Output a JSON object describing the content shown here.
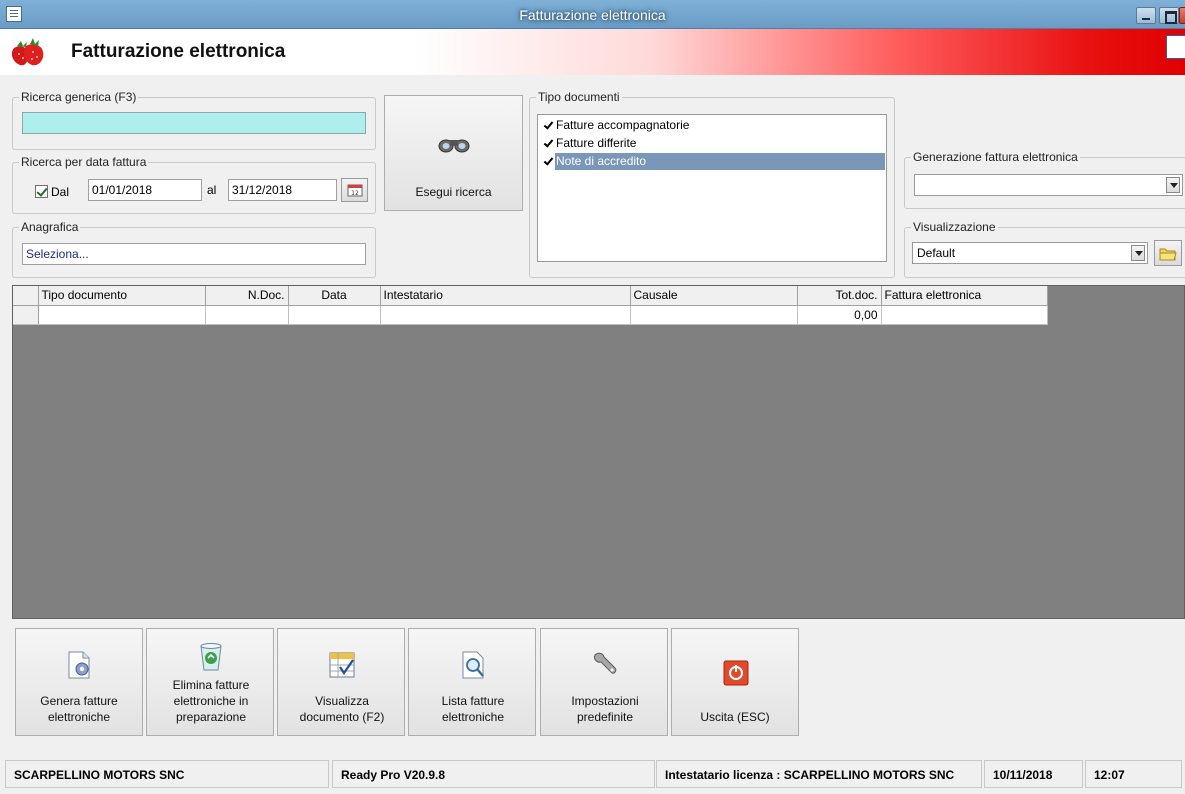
{
  "window": {
    "title": "Fatturazione elettronica"
  },
  "header": {
    "title": "Fatturazione elettronica"
  },
  "search_generic": {
    "legend": "Ricerca generica (F3)",
    "value": ""
  },
  "search_date": {
    "legend": "Ricerca per data fattura",
    "dal_label": "Dal",
    "dal_checked": true,
    "date_from": "01/01/2018",
    "al_label": "al",
    "date_to": "31/12/2018"
  },
  "anagrafica": {
    "legend": "Anagrafica",
    "value": "Seleziona..."
  },
  "search_button": {
    "label": "Esegui ricerca"
  },
  "document_types": {
    "legend": "Tipo documenti",
    "items": [
      {
        "label": "Fatture accompagnatorie",
        "checked": true,
        "selected": false
      },
      {
        "label": "Fatture differite",
        "checked": true,
        "selected": false
      },
      {
        "label": "Note di accredito",
        "checked": true,
        "selected": true
      }
    ]
  },
  "generation": {
    "legend": "Generazione fattura elettronica",
    "value": ""
  },
  "view": {
    "legend": "Visualizzazione",
    "value": "Default"
  },
  "table": {
    "columns": [
      "Tipo documento",
      "N.Doc.",
      "Data",
      "Intestatario",
      "Causale",
      "Tot.doc.",
      "Fattura elettronica"
    ],
    "rows": [
      [
        "",
        "",
        "",
        "",
        "",
        "0,00",
        ""
      ]
    ]
  },
  "actions": [
    {
      "label": "Genera fatture elettroniche",
      "icon": "generate-invoice-icon"
    },
    {
      "label": "Elimina fatture elettroniche in preparazione",
      "icon": "recycle-bin-icon"
    },
    {
      "label": "Visualizza documento (F2)",
      "icon": "view-document-icon"
    },
    {
      "label": "Lista fatture elettroniche",
      "icon": "invoice-list-icon"
    },
    {
      "label": "Impostazioni predefinite",
      "icon": "wrench-icon"
    },
    {
      "label": "Uscita (ESC)",
      "icon": "exit-icon"
    }
  ],
  "status": {
    "company": "SCARPELLINO MOTORS SNC",
    "version": "Ready Pro V20.9.8",
    "license": "Intestatario licenza : SCARPELLINO MOTORS SNC",
    "date": "10/11/2018",
    "time": "12:07"
  },
  "colors": {
    "search_bg": "#aeeeed",
    "selection": "#7a96b8",
    "grid_bg": "#808080",
    "header_red": "#e00000"
  }
}
